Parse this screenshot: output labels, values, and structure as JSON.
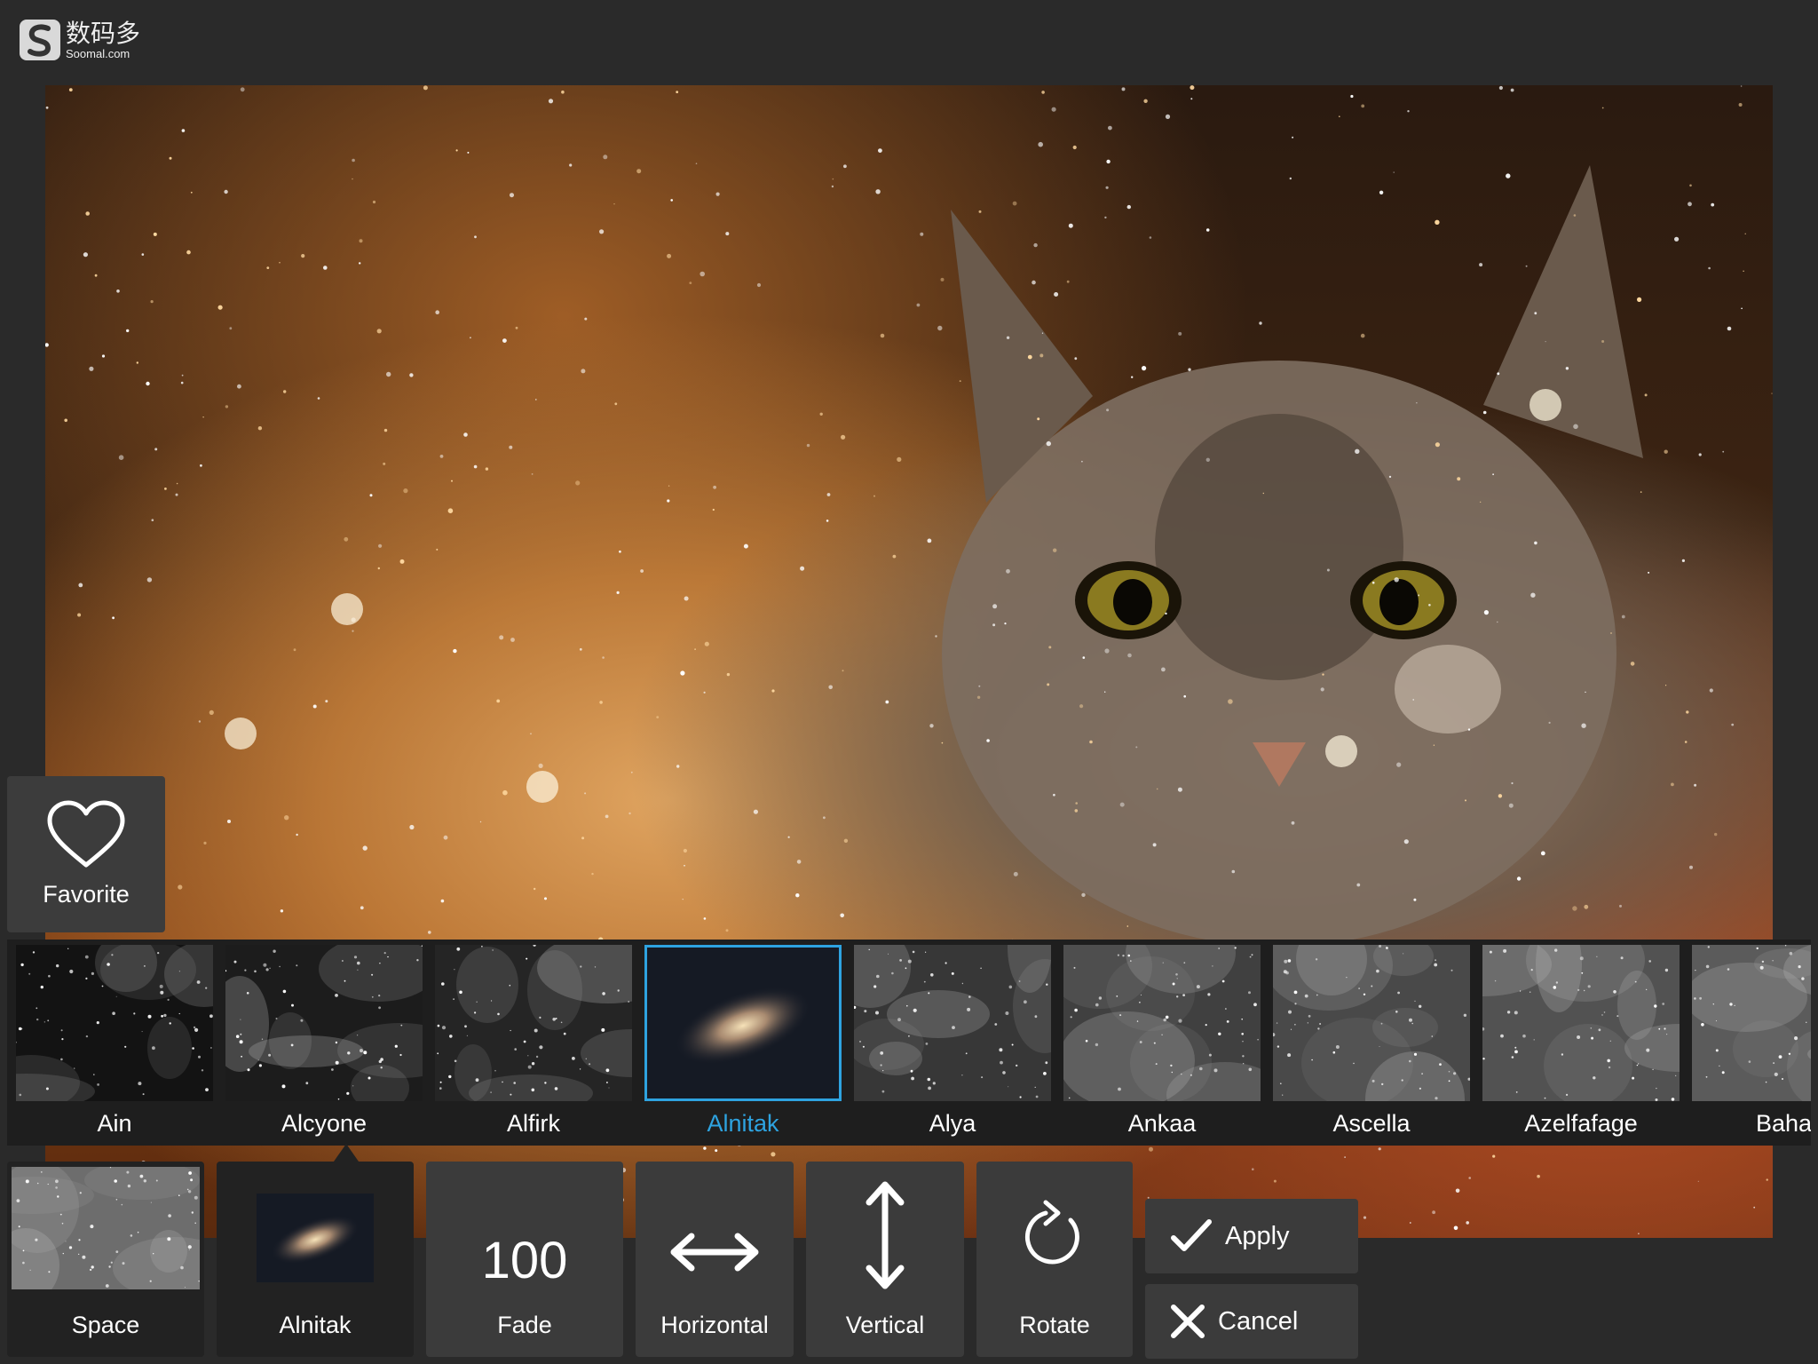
{
  "watermark": {
    "zh": "数码多",
    "en": "Soomal.com"
  },
  "favorite": {
    "label": "Favorite"
  },
  "filters": [
    {
      "label": "Ain",
      "selected": false
    },
    {
      "label": "Alcyone",
      "selected": false
    },
    {
      "label": "Alfirk",
      "selected": false
    },
    {
      "label": "Alnitak",
      "selected": true
    },
    {
      "label": "Alya",
      "selected": false
    },
    {
      "label": "Ankaa",
      "selected": false
    },
    {
      "label": "Ascella",
      "selected": false
    },
    {
      "label": "Azelfafage",
      "selected": false
    },
    {
      "label": "Baha",
      "selected": false
    }
  ],
  "toolbar": {
    "category": "Space",
    "current_effect": "Alnitak",
    "fade_value": "100",
    "fade_label": "Fade",
    "horizontal_label": "Horizontal",
    "vertical_label": "Vertical",
    "rotate_label": "Rotate",
    "apply_label": "Apply",
    "cancel_label": "Cancel"
  },
  "colors": {
    "accent": "#2ea3e0",
    "panel": "#3b3b3b",
    "strip": "#1e1e1e"
  },
  "icons": [
    "heart-icon",
    "horizontal-flip-icon",
    "vertical-flip-icon",
    "rotate-icon",
    "check-icon",
    "close-icon"
  ]
}
